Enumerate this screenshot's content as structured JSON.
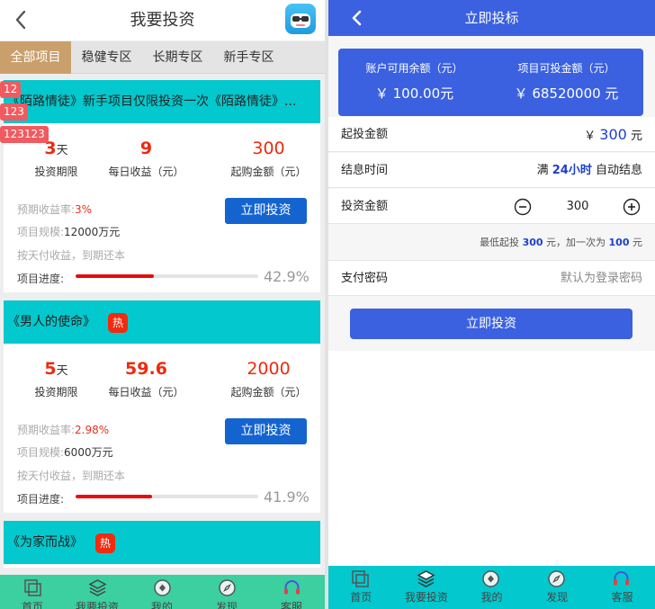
{
  "left": {
    "header": {
      "title": "我要投资"
    },
    "tabs": [
      {
        "label": "全部项目",
        "active": true
      },
      {
        "label": "稳健专区",
        "active": false
      },
      {
        "label": "长期专区",
        "active": false
      },
      {
        "label": "新手专区",
        "active": false
      }
    ],
    "tooltips": [
      "12",
      "123",
      "123123"
    ],
    "projects": [
      {
        "title": "《陌路情徒》新手项目仅限投资一次《陌路情徒》...",
        "hot": false,
        "period_value": "3",
        "period_unit": "天",
        "period_label": "投资期限",
        "daily_value": "9",
        "daily_label": "每日收益（元）",
        "min_value": "300",
        "min_label": "起购金额（元）",
        "rate_label": "预期收益率:",
        "rate_value": "3%",
        "scale_label": "项目规模:",
        "scale_value": "12000万元",
        "method": "按天付收益，到期还本",
        "invest_label": "立即投资",
        "progress_label": "项目进度:",
        "progress_pct": "42.9%",
        "progress_value": 42.9
      },
      {
        "title": "《男人的使命》",
        "hot": true,
        "hot_label": "热",
        "period_value": "5",
        "period_unit": "天",
        "period_label": "投资期限",
        "daily_value": "59.6",
        "daily_label": "每日收益（元）",
        "min_value": "2000",
        "min_label": "起购金额（元）",
        "rate_label": "预期收益率:",
        "rate_value": "2.98%",
        "scale_label": "项目规模:",
        "scale_value": "6000万元",
        "method": "按天付收益，到期还本",
        "invest_label": "立即投资",
        "progress_label": "项目进度:",
        "progress_pct": "41.9%",
        "progress_value": 41.9
      },
      {
        "title": "《为家而战》",
        "hot": true,
        "hot_label": "热"
      }
    ],
    "nav": [
      {
        "label": "首页",
        "icon": "home-icon"
      },
      {
        "label": "我要投资",
        "icon": "layers-icon"
      },
      {
        "label": "我的",
        "icon": "user-icon"
      },
      {
        "label": "发现",
        "icon": "compass-icon"
      },
      {
        "label": "客服",
        "icon": "headset-icon"
      }
    ]
  },
  "right": {
    "header": {
      "title": "立即投标"
    },
    "balance": {
      "available_label": "账户可用余额（元）",
      "available_value": "￥ 100.00元",
      "project_label": "项目可投金额（元）",
      "project_value": "￥ 68520000 元"
    },
    "start_amount": {
      "label": "起投金额",
      "currency": "￥",
      "value": "300",
      "unit": "元"
    },
    "settle_time": {
      "label": "结息时间",
      "prefix": "满",
      "value": "24小时",
      "suffix": "自动结息"
    },
    "invest_amount": {
      "label": "投资金额",
      "value": "300"
    },
    "hint": {
      "part1": "最低起投",
      "min": "300",
      "part2": "元，加一次为",
      "step": "100",
      "part3": "元"
    },
    "password": {
      "label": "支付密码",
      "placeholder": "默认为登录密码"
    },
    "submit_label": "立即投资",
    "nav": [
      {
        "label": "首页",
        "icon": "home-icon"
      },
      {
        "label": "我要投资",
        "icon": "layers-icon"
      },
      {
        "label": "我的",
        "icon": "user-icon"
      },
      {
        "label": "发现",
        "icon": "compass-icon"
      },
      {
        "label": "客服",
        "icon": "headset-icon"
      }
    ]
  },
  "colors": {
    "left_tab_active": "#c9a06c",
    "card_head": "#03c8ce",
    "invest_button": "#1464d0",
    "accent_red": "#ee2a0e",
    "right_primary": "#3b61e0",
    "left_nav": "#3ccfa0",
    "right_nav": "#03c8ce"
  }
}
